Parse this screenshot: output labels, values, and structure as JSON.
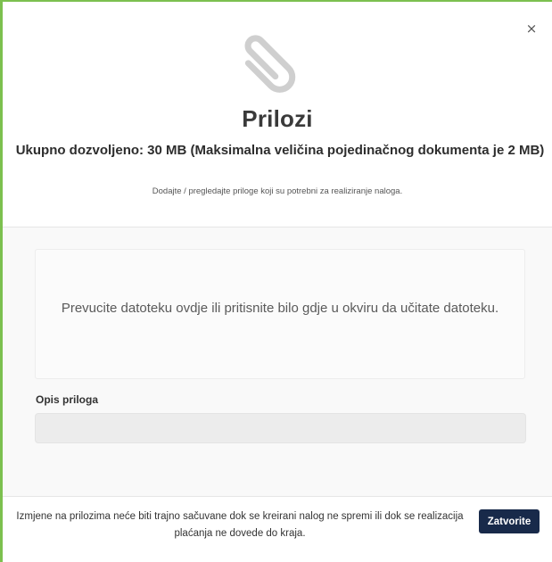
{
  "modal": {
    "close_glyph": "×",
    "icon": "paperclip-icon",
    "title": "Prilozi",
    "subtitle": "Ukupno dozvoljeno: 30 MB (Maksimalna veličina pojedinačnog dokumenta je 2 MB)",
    "hint": "Dodajte / pregledajte priloge koji su potrebni za realiziranje naloga."
  },
  "dropzone": {
    "text": "Prevucite datoteku ovdje ili pritisnite bilo gdje u okviru da učitate datoteku."
  },
  "description": {
    "label": "Opis priloga",
    "value": "",
    "placeholder": ""
  },
  "footer": {
    "note": "Izmjene na prilozima neće biti trajno sačuvane dok se kreirani nalog ne spremi ili dok se realizacija plaćanja ne dovede do kraja.",
    "close_label": "Zatvorite"
  },
  "colors": {
    "accent": "#7cc04f",
    "primary_button": "#182a4a",
    "icon": "#cfcfcf"
  }
}
